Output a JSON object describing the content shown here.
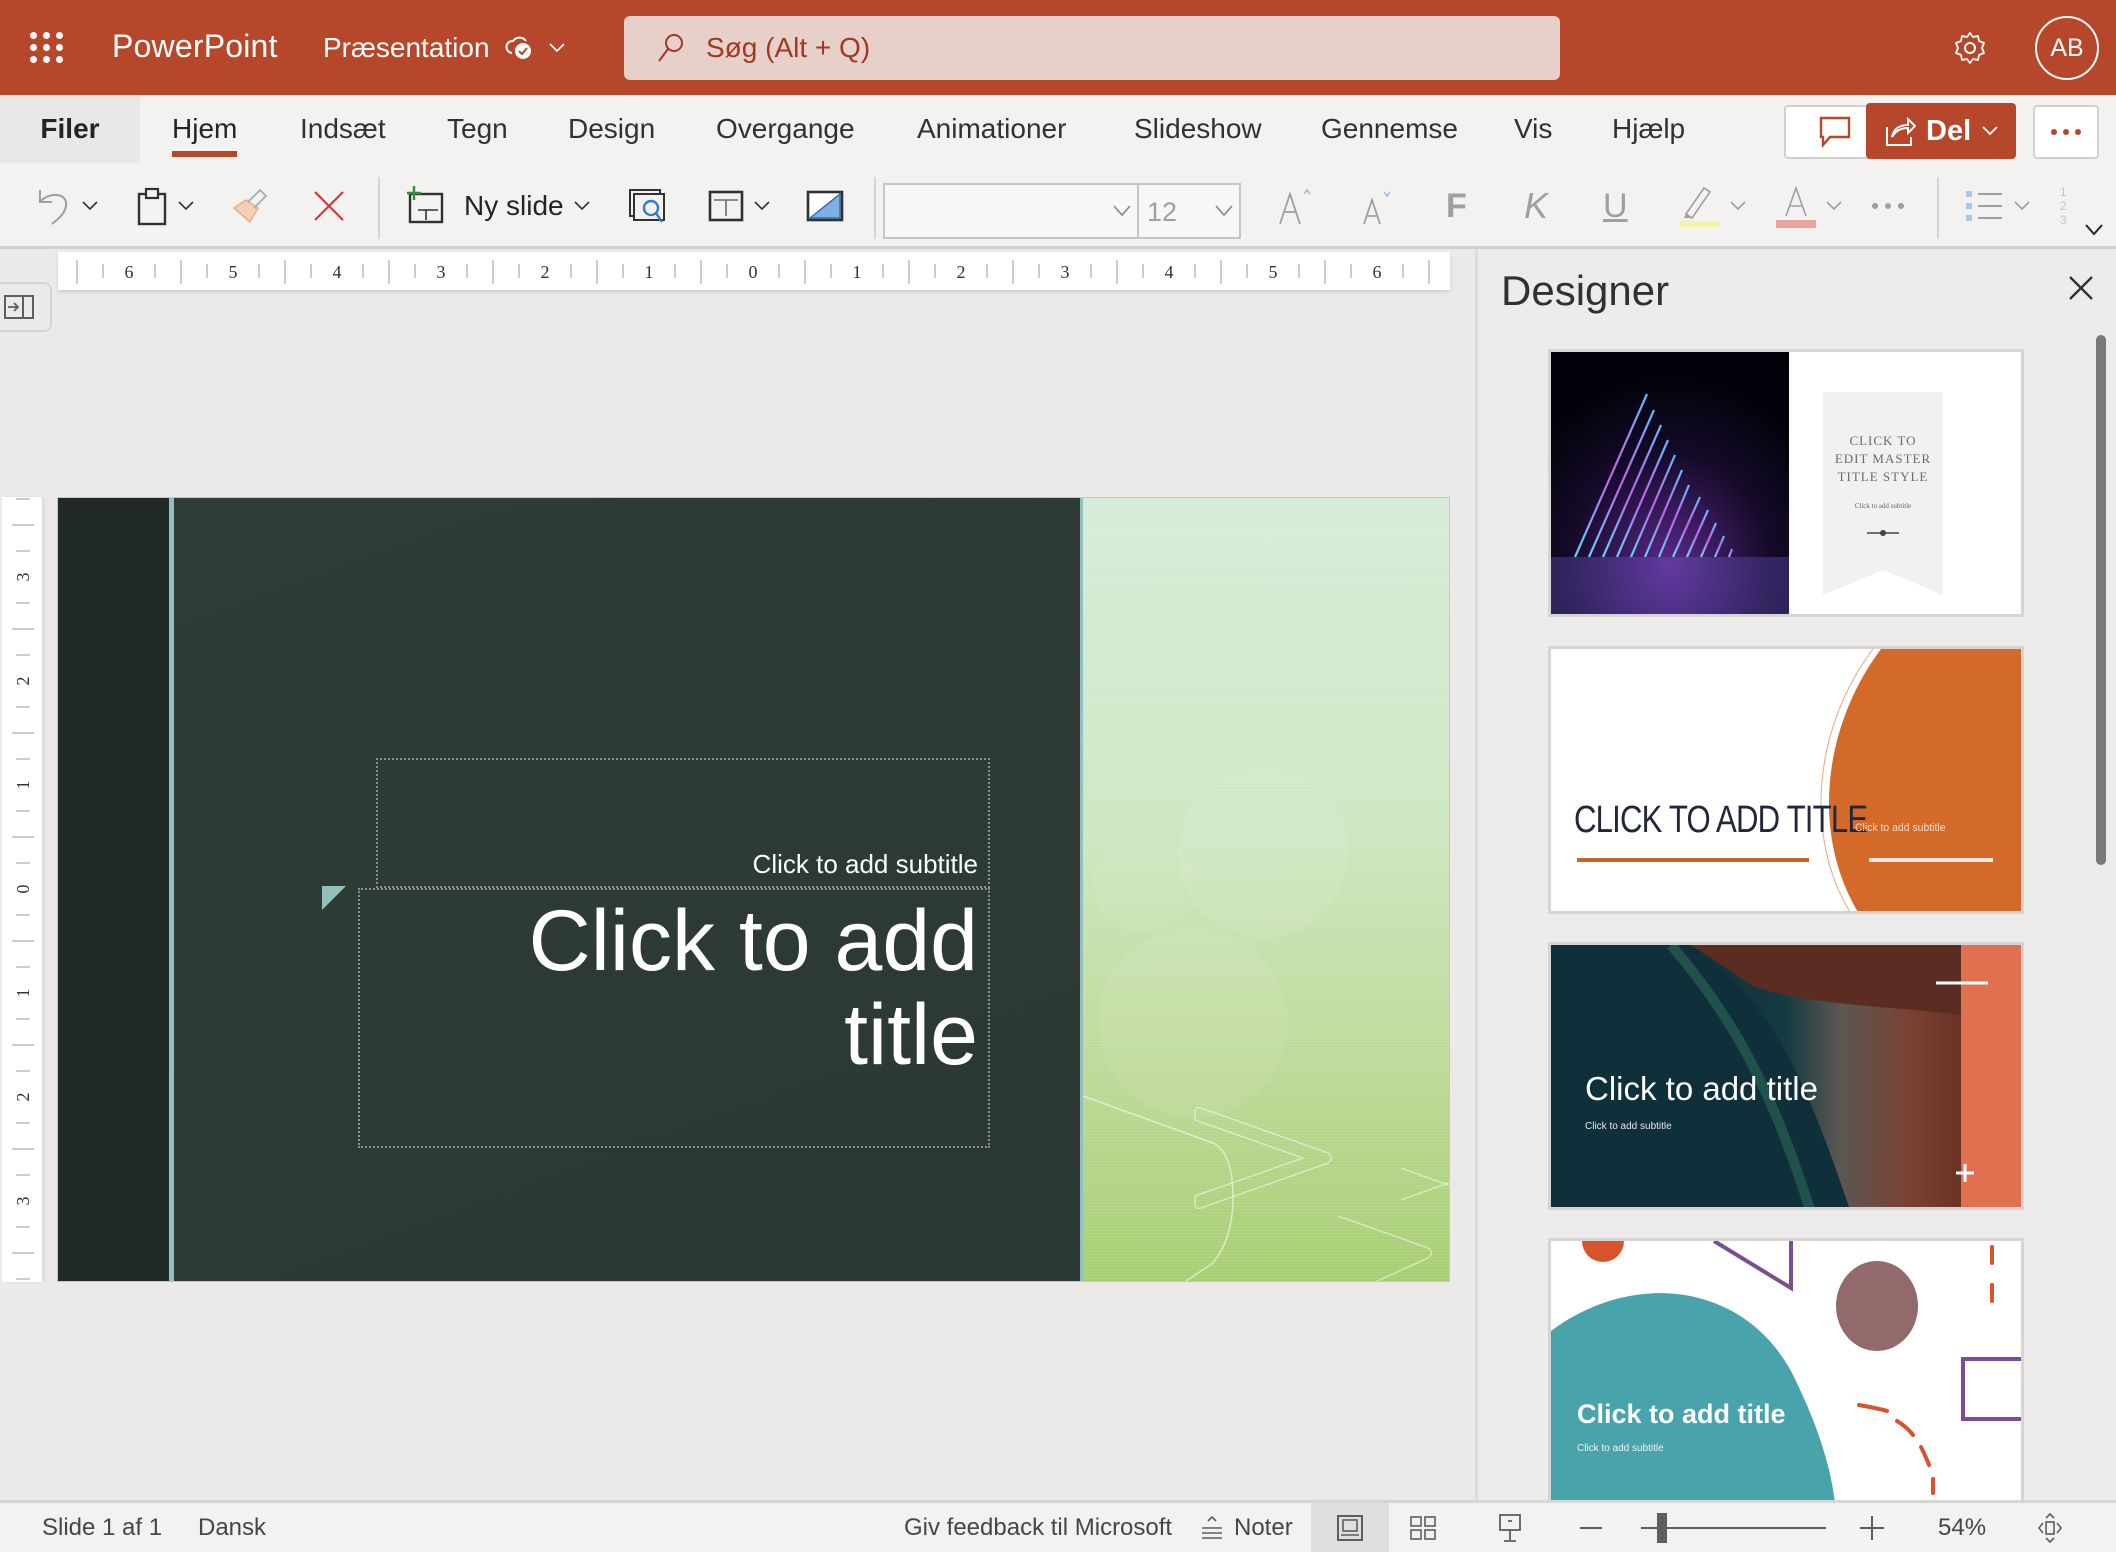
{
  "header": {
    "app_name": "PowerPoint",
    "doc_title": "Præsentation",
    "search_placeholder": "Søg (Alt + Q)",
    "avatar_initials": "AB",
    "brand_color": "#B7472A"
  },
  "tabs": {
    "items": [
      "Filer",
      "Hjem",
      "Indsæt",
      "Tegn",
      "Design",
      "Overgange",
      "Animationer",
      "Slideshow",
      "Gennemse",
      "Vis",
      "Hjælp"
    ],
    "active": "Hjem"
  },
  "actions": {
    "share_label": "Del"
  },
  "toolbar": {
    "new_slide_label": "Ny slide",
    "font_name": "",
    "font_size": "12",
    "bold_glyph": "F",
    "italic_glyph": "K",
    "underline_glyph": "U"
  },
  "ruler": {
    "horizontal_labels": [
      "6",
      "5",
      "4",
      "3",
      "2",
      "1",
      "0",
      "1",
      "2",
      "3",
      "4",
      "5",
      "6"
    ],
    "vertical_labels": [
      "3",
      "2",
      "1",
      "0",
      "1",
      "2",
      "3"
    ]
  },
  "slide": {
    "subtitle_placeholder": "Click to add subtitle",
    "title_placeholder": "Click to add title"
  },
  "designer": {
    "title": "Designer",
    "cards": [
      {
        "title": "CLICK TO EDIT MASTER TITLE STYLE",
        "subtitle": "Click to add subtitle"
      },
      {
        "title": "CLICK TO ADD TITLE",
        "subtitle": "Click to add subtitle"
      },
      {
        "title": "Click to add title",
        "subtitle": "Click to add subtitle"
      },
      {
        "title": "Click to add title",
        "subtitle": "Click to add subtitle"
      }
    ]
  },
  "statusbar": {
    "slide_counter": "Slide 1 af 1",
    "language": "Dansk",
    "feedback": "Giv feedback til Microsoft",
    "notes": "Noter",
    "zoom_percent": "54%",
    "zoom_value": 54
  }
}
